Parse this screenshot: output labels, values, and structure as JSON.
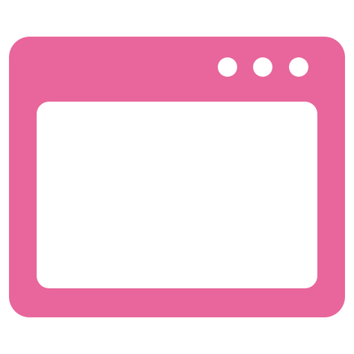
{
  "icon": {
    "name": "browser-window-icon",
    "accent_color": "#E8669C",
    "inner_color": "#FFFFFF",
    "window_controls": [
      "dot",
      "dot",
      "dot"
    ]
  }
}
